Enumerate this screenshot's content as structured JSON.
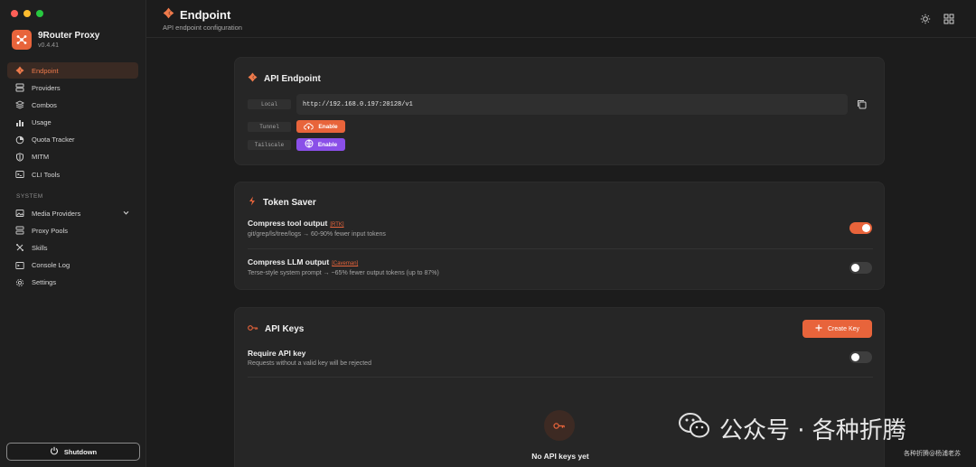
{
  "app": {
    "name": "9Router Proxy",
    "version": "v0.4.41"
  },
  "sidebar": {
    "items": [
      {
        "label": "Endpoint",
        "icon": "endpoint-icon",
        "active": true
      },
      {
        "label": "Providers",
        "icon": "providers-icon"
      },
      {
        "label": "Combos",
        "icon": "combos-icon"
      },
      {
        "label": "Usage",
        "icon": "usage-icon"
      },
      {
        "label": "Quota Tracker",
        "icon": "quota-icon"
      },
      {
        "label": "MITM",
        "icon": "shield-icon"
      },
      {
        "label": "CLI Tools",
        "icon": "terminal-icon"
      }
    ],
    "section_label": "SYSTEM",
    "system_items": [
      {
        "label": "Media Providers",
        "icon": "media-icon"
      },
      {
        "label": "Proxy Pools",
        "icon": "pools-icon"
      },
      {
        "label": "Skills",
        "icon": "skills-icon"
      },
      {
        "label": "Console Log",
        "icon": "console-icon"
      },
      {
        "label": "Settings",
        "icon": "gear-icon"
      }
    ],
    "shutdown_label": "Shutdown"
  },
  "header": {
    "title": "Endpoint",
    "subtitle": "API endpoint configuration"
  },
  "api_endpoint": {
    "title": "API Endpoint",
    "local_tag": "Local",
    "local_url": "http://192.168.0.197:20128/v1",
    "tunnel_tag": "Tunnel",
    "tunnel_button": "Enable",
    "tailscale_tag": "Tailscale",
    "tailscale_button": "Enable"
  },
  "token_saver": {
    "title": "Token Saver",
    "row1_title": "Compress tool output",
    "row1_link": "[RTK]",
    "row1_desc": "git/grep/ls/tree/logs → 60-90% fewer input tokens",
    "row1_on": true,
    "row2_title": "Compress LLM output",
    "row2_link": "[Caveman]",
    "row2_desc": "Terse-style system prompt → ~65% fewer output tokens (up to 87%)",
    "row2_on": false
  },
  "api_keys": {
    "title": "API Keys",
    "create_button": "Create Key",
    "require_title": "Require API key",
    "require_desc": "Requests without a valid key will be rejected",
    "require_on": false,
    "empty_text": "No API keys yet"
  },
  "watermark": {
    "main": "公众号 · 各种折腾",
    "small": "各种折腾@杨浦老苏"
  },
  "colors": {
    "accent": "#e8643b",
    "purple": "#8a4fe8",
    "background": "#1c1c1c",
    "card": "#262626"
  }
}
